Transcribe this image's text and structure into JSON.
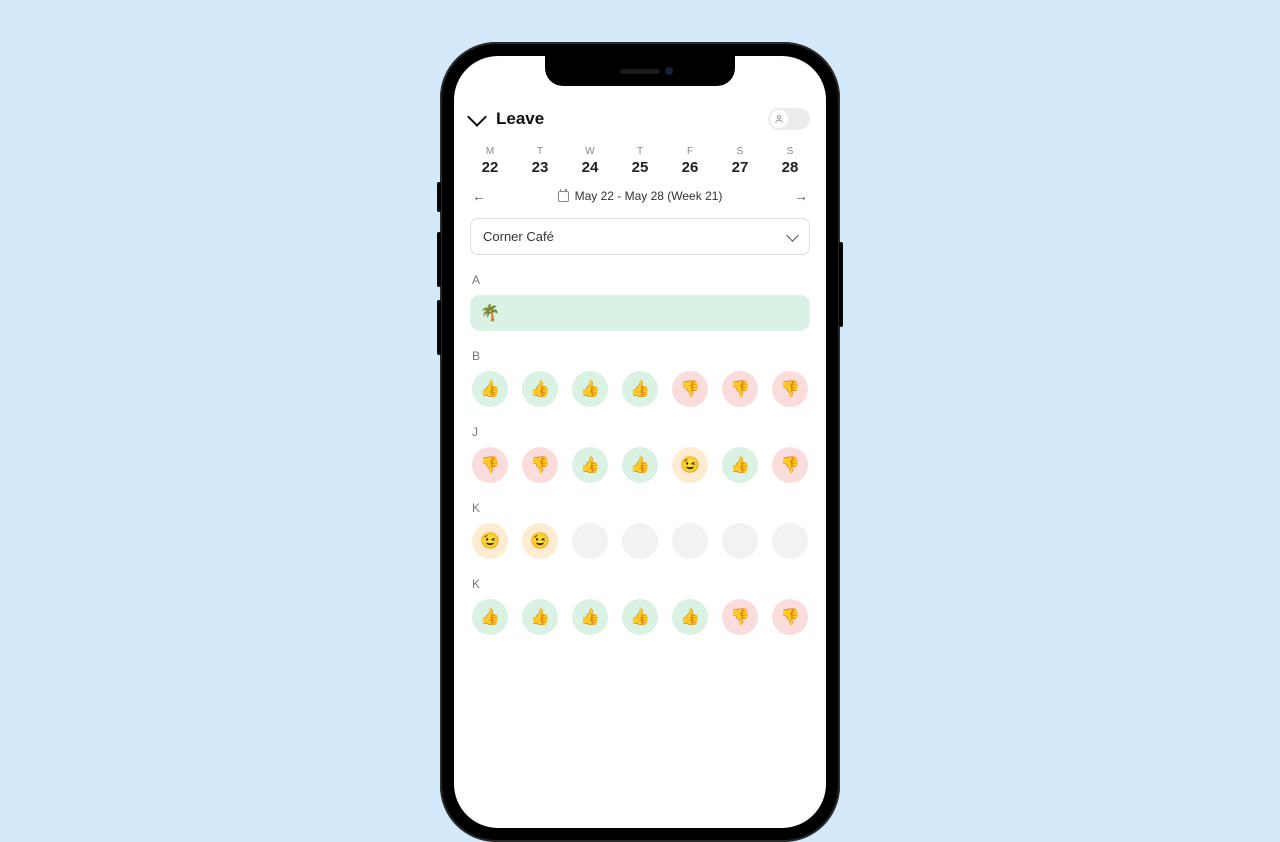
{
  "header": {
    "title": "Leave",
    "user_icon": "person-icon"
  },
  "days": [
    {
      "dow": "M",
      "num": "22"
    },
    {
      "dow": "T",
      "num": "23"
    },
    {
      "dow": "W",
      "num": "24"
    },
    {
      "dow": "T",
      "num": "25"
    },
    {
      "dow": "F",
      "num": "26"
    },
    {
      "dow": "S",
      "num": "27"
    },
    {
      "dow": "S",
      "num": "28"
    }
  ],
  "weekNav": {
    "label": "May 22 - May 28 (Week 21)"
  },
  "location": {
    "selected": "Corner Café"
  },
  "sections": [
    {
      "label": "A",
      "type": "leave",
      "leave_icon": "🌴"
    },
    {
      "label": "B",
      "type": "cells",
      "cells": [
        {
          "kind": "up",
          "emoji": "👍"
        },
        {
          "kind": "up",
          "emoji": "👍"
        },
        {
          "kind": "up",
          "emoji": "👍"
        },
        {
          "kind": "up",
          "emoji": "👍"
        },
        {
          "kind": "down",
          "emoji": "👎"
        },
        {
          "kind": "down",
          "emoji": "👎"
        },
        {
          "kind": "down",
          "emoji": "👎"
        }
      ]
    },
    {
      "label": "J",
      "type": "cells",
      "cells": [
        {
          "kind": "down",
          "emoji": "👎"
        },
        {
          "kind": "down",
          "emoji": "👎"
        },
        {
          "kind": "up",
          "emoji": "👍"
        },
        {
          "kind": "up",
          "emoji": "👍"
        },
        {
          "kind": "maybe",
          "emoji": "😉"
        },
        {
          "kind": "up",
          "emoji": "👍"
        },
        {
          "kind": "down",
          "emoji": "👎"
        }
      ]
    },
    {
      "label": "K",
      "type": "cells",
      "cells": [
        {
          "kind": "maybe",
          "emoji": "😉"
        },
        {
          "kind": "maybe",
          "emoji": "😉"
        },
        {
          "kind": "empty",
          "emoji": ""
        },
        {
          "kind": "empty",
          "emoji": ""
        },
        {
          "kind": "empty",
          "emoji": ""
        },
        {
          "kind": "empty",
          "emoji": ""
        },
        {
          "kind": "empty",
          "emoji": ""
        }
      ]
    },
    {
      "label": "K",
      "type": "cells",
      "cells": [
        {
          "kind": "up",
          "emoji": "👍"
        },
        {
          "kind": "up",
          "emoji": "👍"
        },
        {
          "kind": "up",
          "emoji": "👍"
        },
        {
          "kind": "up",
          "emoji": "👍"
        },
        {
          "kind": "up",
          "emoji": "👍"
        },
        {
          "kind": "down",
          "emoji": "👎"
        },
        {
          "kind": "down",
          "emoji": "👎"
        }
      ]
    }
  ]
}
